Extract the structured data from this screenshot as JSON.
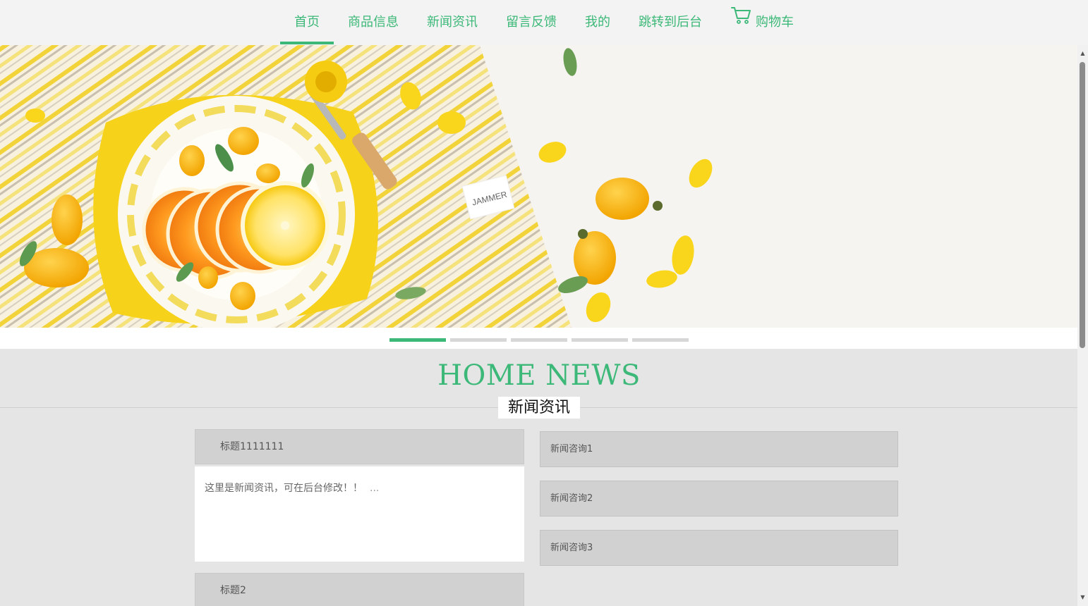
{
  "nav": {
    "items": [
      {
        "label": "首页"
      },
      {
        "label": "商品信息"
      },
      {
        "label": "新闻资讯"
      },
      {
        "label": "留言反馈"
      },
      {
        "label": "我的"
      },
      {
        "label": "跳转到后台"
      },
      {
        "label": "购物车",
        "icon": "cart-icon"
      }
    ],
    "active": "首页"
  },
  "carousel": {
    "slide_count": 5,
    "active_slide": 1,
    "label_text": "JAMMER"
  },
  "section": {
    "title": "HOME NEWS",
    "subtitle": "新闻资讯"
  },
  "news": {
    "featured": {
      "title": "标题1111111",
      "summary": "这里是新闻资讯，可在后台修改！！",
      "more": "..."
    },
    "second": {
      "title": "标题2"
    },
    "list": [
      {
        "title": "新闻咨询1"
      },
      {
        "title": "新闻咨询2"
      },
      {
        "title": "新闻咨询3"
      }
    ]
  },
  "colors": {
    "accent": "#3cb878",
    "nav_bg": "#f3f3f3",
    "page_bg": "#e5e5e5",
    "card_header": "#d1d1d1"
  }
}
